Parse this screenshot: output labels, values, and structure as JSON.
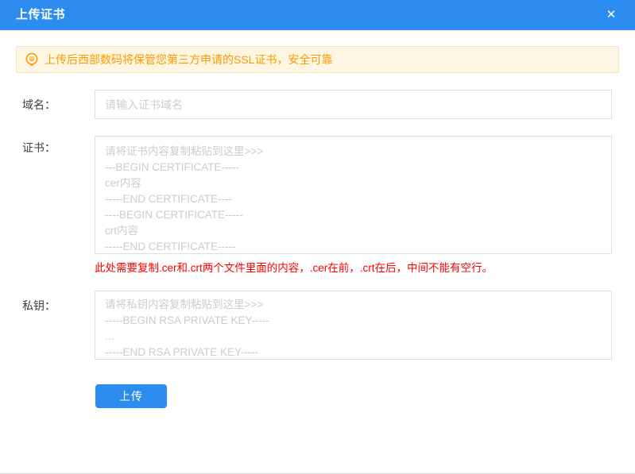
{
  "theme": {
    "header_bg": "#2d8cf0",
    "accent_blue": "#2d8cf0",
    "notice_bg": "#fdf6e2",
    "notice_border": "#f1e6c4",
    "notice_text": "#ff9900",
    "error_text": "#ff0000",
    "field_border": "#dfdfdf",
    "placeholder_color": "#cccccc",
    "page_border": "#d8d8d8"
  },
  "header": {
    "title": "上传证书",
    "close_icon": "✕"
  },
  "notice": {
    "icon": "lightbulb-icon",
    "text": "上传后西部数码将保管您第三方申请的SSL证书，安全可靠"
  },
  "form": {
    "domain": {
      "label": "域名：",
      "value": "",
      "placeholder": "请输入证书域名"
    },
    "certificate": {
      "label": "证书：",
      "value": "",
      "placeholder": "请将证书内容复制粘贴到这里>>>\n---BEGIN CERTIFICATE-----\ncer内容\n-----END CERTIFICATE----\n----BEGIN CERTIFICATE-----\ncrt内容\n-----END CERTIFICATE-----",
      "hint": "此处需要复制.cer和.crt两个文件里面的内容，.cer在前，.crt在后，中间不能有空行。"
    },
    "private_key": {
      "label": "私钥：",
      "value": "",
      "placeholder": "请将私钥内容复制粘贴到这里>>>\n-----BEGIN RSA PRIVATE KEY-----\n...\n-----END RSA PRIVATE KEY-----"
    },
    "submit_label": "上传"
  }
}
